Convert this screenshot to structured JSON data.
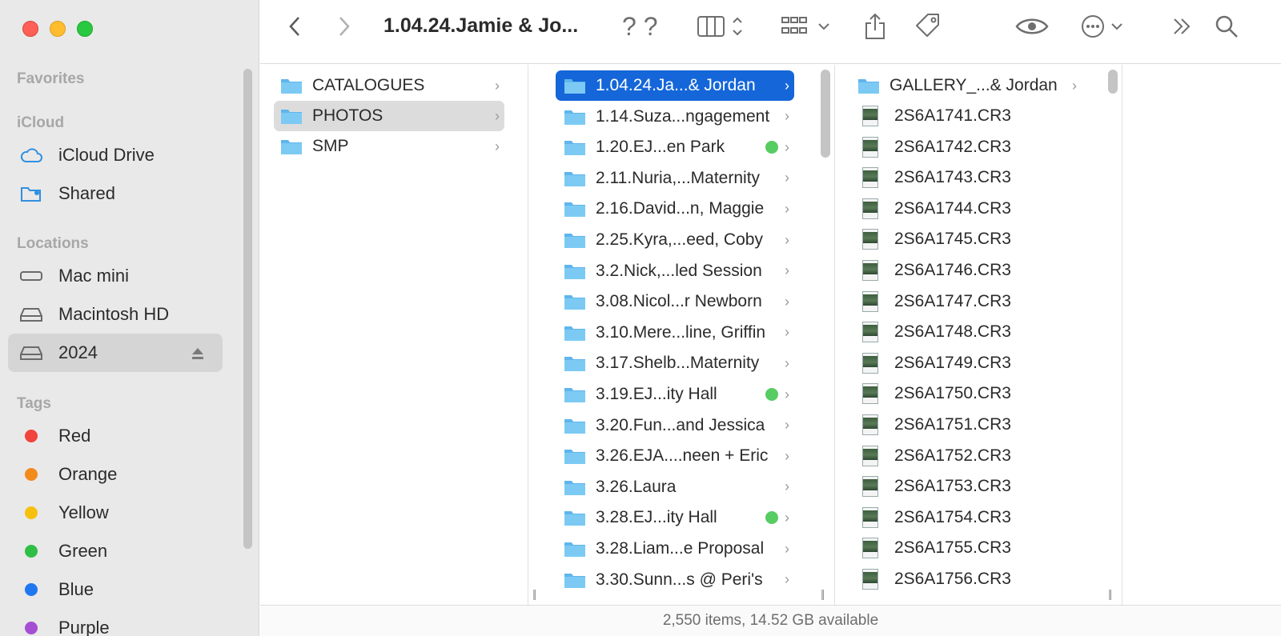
{
  "window": {
    "title": "1.04.24.Jamie & Jo...",
    "status": "2,550 items, 14.52 GB available"
  },
  "sidebar": {
    "favorites_header": "Favorites",
    "icloud_header": "iCloud",
    "icloud_items": [
      {
        "label": "iCloud Drive",
        "icon": "cloud-icon"
      },
      {
        "label": "Shared",
        "icon": "shared-folder-icon"
      }
    ],
    "locations_header": "Locations",
    "location_items": [
      {
        "label": "Mac mini",
        "icon": "mac-mini-icon"
      },
      {
        "label": "Macintosh HD",
        "icon": "hard-drive-icon"
      },
      {
        "label": "2024",
        "icon": "external-drive-icon",
        "selected": true
      }
    ],
    "tags_header": "Tags",
    "tags": [
      {
        "label": "Red",
        "color": "#f2433c"
      },
      {
        "label": "Orange",
        "color": "#f28a1c"
      },
      {
        "label": "Yellow",
        "color": "#f6c10e"
      },
      {
        "label": "Green",
        "color": "#2fbf47"
      },
      {
        "label": "Blue",
        "color": "#1f78f0"
      },
      {
        "label": "Purple",
        "color": "#a550d3"
      }
    ]
  },
  "toolbar": {
    "icons": [
      "back-icon",
      "forward-icon",
      "help-icon",
      "column-view-icon",
      "group-icon",
      "share-icon",
      "tag-icon",
      "quicklook-icon",
      "more-icon",
      "overflow-icon",
      "search-icon"
    ]
  },
  "columns": {
    "col1": [
      {
        "label": "CATALOGUES"
      },
      {
        "label": "PHOTOS",
        "selected": true
      },
      {
        "label": "SMP"
      }
    ],
    "col2": [
      {
        "label": "1.04.24.Ja...& Jordan",
        "selected": true
      },
      {
        "label": "1.14.Suza...ngagement"
      },
      {
        "label": "1.20.EJ...en Park",
        "tag": true
      },
      {
        "label": "2.11.Nuria,...Maternity"
      },
      {
        "label": "2.16.David...n, Maggie"
      },
      {
        "label": "2.25.Kyra,...eed, Coby"
      },
      {
        "label": "3.2.Nick,...led Session"
      },
      {
        "label": "3.08.Nicol...r Newborn"
      },
      {
        "label": "3.10.Mere...line, Griffin"
      },
      {
        "label": "3.17.Shelb...Maternity"
      },
      {
        "label": "3.19.EJ...ity Hall",
        "tag": true
      },
      {
        "label": "3.20.Fun...and Jessica"
      },
      {
        "label": "3.26.EJA....neen + Eric"
      },
      {
        "label": "3.26.Laura"
      },
      {
        "label": "3.28.EJ...ity Hall",
        "tag": true
      },
      {
        "label": "3.28.Liam...e Proposal"
      },
      {
        "label": "3.30.Sunn...s @ Peri's"
      }
    ],
    "col3_folder": "GALLERY_...& Jordan",
    "col3_files": [
      "2S6A1741.CR3",
      "2S6A1742.CR3",
      "2S6A1743.CR3",
      "2S6A1744.CR3",
      "2S6A1745.CR3",
      "2S6A1746.CR3",
      "2S6A1747.CR3",
      "2S6A1748.CR3",
      "2S6A1749.CR3",
      "2S6A1750.CR3",
      "2S6A1751.CR3",
      "2S6A1752.CR3",
      "2S6A1753.CR3",
      "2S6A1754.CR3",
      "2S6A1755.CR3",
      "2S6A1756.CR3"
    ]
  }
}
